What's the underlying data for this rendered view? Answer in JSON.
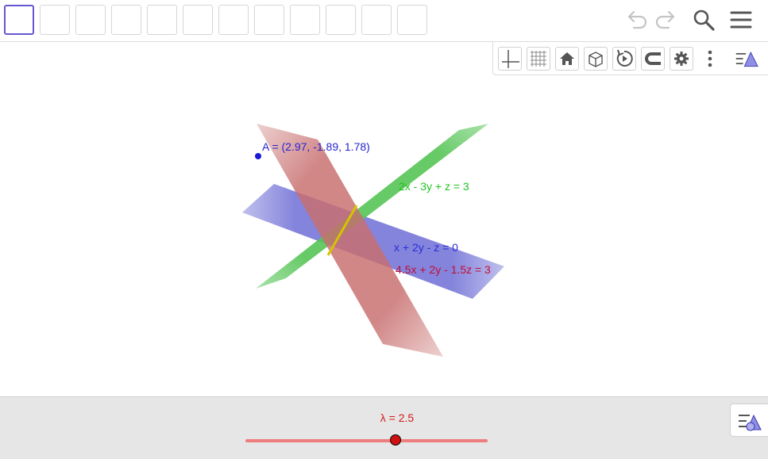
{
  "toolbar": {
    "tool_count": 12,
    "selected_tool_index": 0,
    "icons": [
      "undo-icon",
      "redo-icon",
      "search-icon",
      "menu-icon"
    ]
  },
  "stylebar": {
    "buttons": [
      "axes-icon",
      "grid-icon",
      "home-icon",
      "view-cube-icon",
      "rotate-view-icon",
      "point-capturing-icon",
      "settings-icon",
      "more-options-icon",
      "algebra-toggle-icon"
    ]
  },
  "graphics": {
    "point": {
      "label": "A = (2.97, -1.89, 1.78)",
      "color": "#1a1ad6"
    },
    "planes": [
      {
        "id": "green",
        "label": "2x - 3y + z = 3",
        "color": "#3cbe3c"
      },
      {
        "id": "blue",
        "label": "x + 2y - z = 0",
        "color": "#2d2dd8"
      },
      {
        "id": "red",
        "label": "4.5x + 2y - 1.5z = 3",
        "color": "#c00d36"
      }
    ],
    "line_color": "#d4c400"
  },
  "slider": {
    "label": "λ = 2.5",
    "value": 2.5,
    "position_fraction": 0.62,
    "track_color": "#ee7d7d",
    "knob_color": "#d01010"
  }
}
